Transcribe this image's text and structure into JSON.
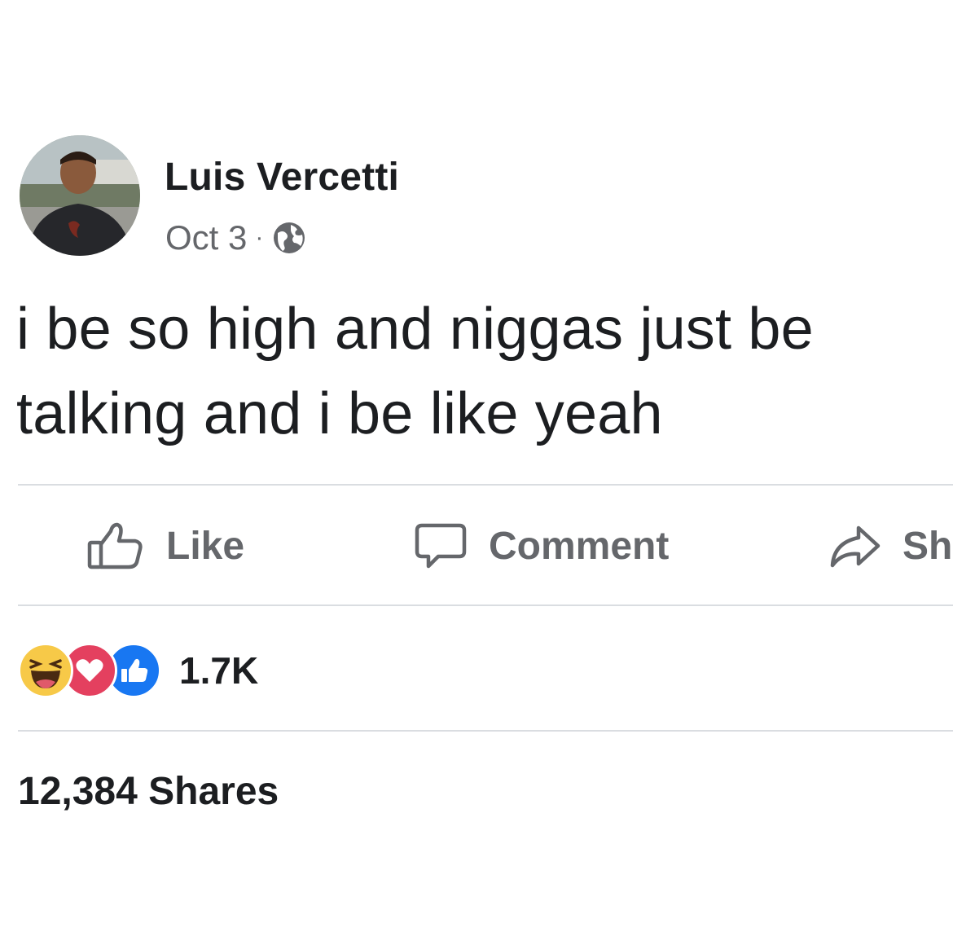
{
  "post": {
    "author": "Luis Vercetti",
    "date": "Oct 3",
    "separator": "·",
    "privacy_icon": "globe-icon",
    "text": "i be so high and niggas just be talking and i be like yeah"
  },
  "actions": {
    "like_label": "Like",
    "comment_label": "Comment",
    "share_label": "Sh"
  },
  "reactions": {
    "icons": [
      "haha-icon",
      "love-icon",
      "like-icon"
    ],
    "count": "1.7K"
  },
  "shares": {
    "label": "12,384 Shares"
  },
  "colors": {
    "text_primary": "#1c1e21",
    "text_secondary": "#65676b",
    "divider": "#dadde1",
    "like_blue": "#1877f2",
    "love_red": "#e4405f",
    "haha_yellow": "#f7c948"
  }
}
